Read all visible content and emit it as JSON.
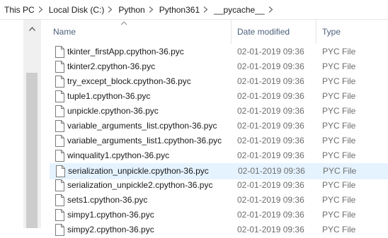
{
  "breadcrumb": {
    "items": [
      "This PC",
      "Local Disk (C:)",
      "Python",
      "Python361",
      "__pycache__"
    ]
  },
  "columns": {
    "name": "Name",
    "date_modified": "Date modified",
    "type": "Type"
  },
  "files": [
    {
      "name": "tkinter_firstApp.cpython-36.pyc",
      "date": "02-01-2019 09:36",
      "type": "PYC File"
    },
    {
      "name": "tkinter2.cpython-36.pyc",
      "date": "02-01-2019 09:36",
      "type": "PYC File"
    },
    {
      "name": "try_except_block.cpython-36.pyc",
      "date": "02-01-2019 09:36",
      "type": "PYC File"
    },
    {
      "name": "tuple1.cpython-36.pyc",
      "date": "02-01-2019 09:36",
      "type": "PYC File"
    },
    {
      "name": "unpickle.cpython-36.pyc",
      "date": "02-01-2019 09:36",
      "type": "PYC File"
    },
    {
      "name": "variable_arguments_list.cpython-36.pyc",
      "date": "02-01-2019 09:36",
      "type": "PYC File"
    },
    {
      "name": "variable_arguments_list1.cpython-36.pyc",
      "date": "02-01-2019 09:36",
      "type": "PYC File"
    },
    {
      "name": "winquality1.cpython-36.pyc",
      "date": "02-01-2019 09:36",
      "type": "PYC File"
    },
    {
      "name": "serialization_unpickle.cpython-36.pyc",
      "date": "02-01-2019 09:36",
      "type": "PYC File"
    },
    {
      "name": "serialization_unpickle2.cpython-36.pyc",
      "date": "02-01-2019 09:36",
      "type": "PYC File"
    },
    {
      "name": "sets1.cpython-36.pyc",
      "date": "02-01-2019 09:36",
      "type": "PYC File"
    },
    {
      "name": "simpy1.cpython-36.pyc",
      "date": "02-01-2019 09:36",
      "type": "PYC File"
    },
    {
      "name": "simpy2.cpython-36.pyc",
      "date": "02-01-2019 09:36",
      "type": "PYC File"
    }
  ],
  "selected_file": "serialization_unpickle.cpython-36.pyc",
  "icons": {
    "separator": "chevron-right-icon",
    "scroll_up": "chevron-up-icon",
    "sort": "sort-ascending-icon",
    "file": "pyc-file-icon"
  },
  "colors": {
    "selection": "#e5f3ff",
    "header_text": "#4c607a",
    "secondary_text": "#6d6d6d"
  }
}
